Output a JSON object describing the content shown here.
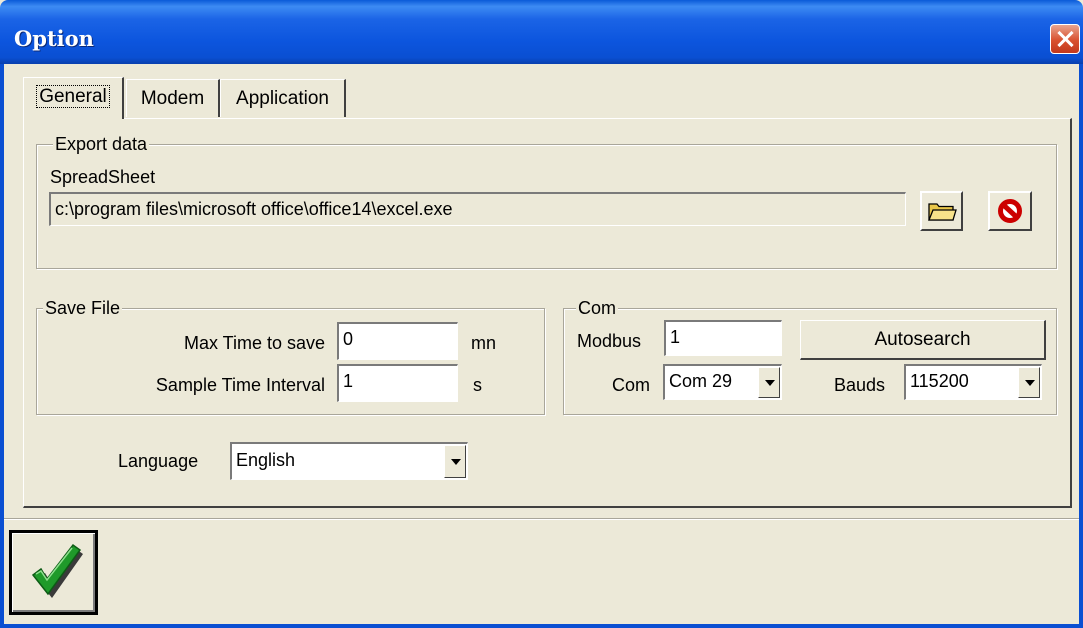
{
  "window": {
    "title": "Option"
  },
  "tabs": [
    {
      "label": "General",
      "active": true
    },
    {
      "label": "Modem",
      "active": false
    },
    {
      "label": "Application",
      "active": false
    }
  ],
  "export": {
    "legend": "Export data",
    "spreadsheet_label": "SpreadSheet",
    "spreadsheet_path": "c:\\program files\\microsoft office\\office14\\excel.exe",
    "browse_icon": "folder-icon",
    "clear_icon": "no-entry-icon"
  },
  "save_file": {
    "legend": "Save File",
    "max_time_label": "Max Time to save",
    "max_time_value": "0",
    "max_time_unit": "mn",
    "sample_label": "Sample Time Interval",
    "sample_value": "1",
    "sample_unit": "s"
  },
  "com": {
    "legend": "Com",
    "modbus_label": "Modbus",
    "modbus_value": "1",
    "autosearch_label": "Autosearch",
    "com_label": "Com",
    "com_value": "Com 29",
    "bauds_label": "Bauds",
    "bauds_value": "115200"
  },
  "language": {
    "label": "Language",
    "value": "English"
  },
  "ok_icon": "checkmark-icon",
  "colors": {
    "titlebar": "#0a4fd2",
    "face": "#ece9d8",
    "close": "#d9512f",
    "check": "#1f9a2a",
    "stop": "#cc0000"
  }
}
